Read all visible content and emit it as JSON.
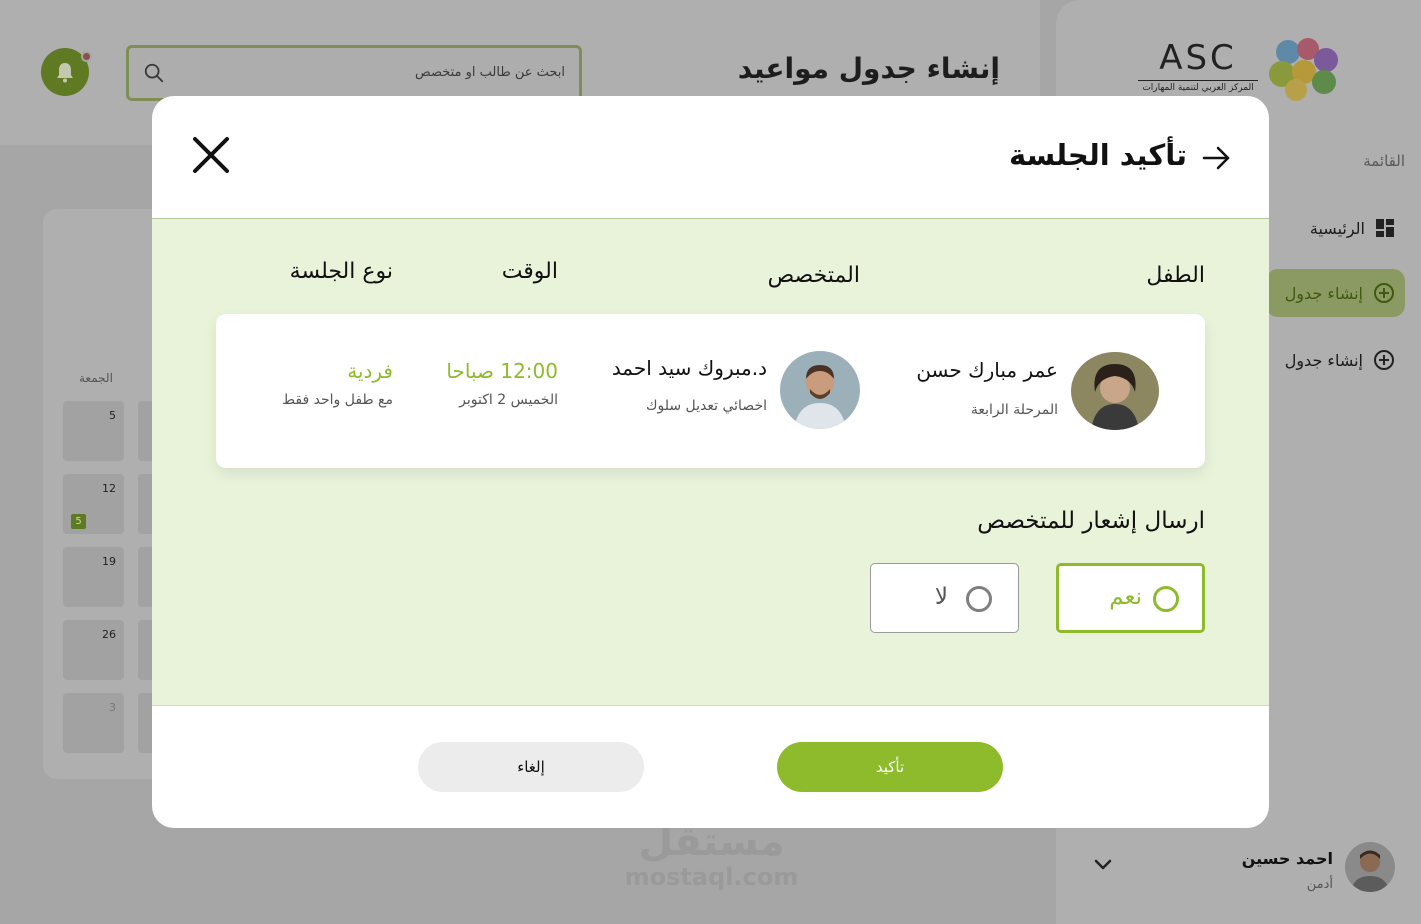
{
  "app": {
    "logo_text": "ASC",
    "logo_subtitle": "المركز العربي لتنمية المهارات",
    "page_title": "إنشاء جدول مواعيد",
    "search_placeholder": "ابحث عن طالب او متخصص"
  },
  "sidebar": {
    "caption": "القائمة",
    "items": [
      {
        "label": "الرئيسية",
        "icon": "dashboard-icon"
      },
      {
        "label": "إنشاء جدول",
        "icon": "plus-circle-icon"
      },
      {
        "label": "إنشاء جدول",
        "icon": "plus-circle-icon"
      }
    ],
    "profile": {
      "name": "احمد حسين",
      "role": "أدمن"
    }
  },
  "calendar": {
    "day_name": "الجمعة",
    "days": [
      "5",
      "12",
      "19",
      "26",
      "3"
    ],
    "badge": "5"
  },
  "modal": {
    "title": "تأكيد الجلسة",
    "columns": {
      "child": "الطفل",
      "specialist": "المتخصص",
      "time": "الوقت",
      "session_type": "نوع الجلسة"
    },
    "child": {
      "name": "عمر مبارك حسن",
      "level": "المرحلة الرابعة"
    },
    "specialist": {
      "name": "د.مبروك سيد احمد",
      "title": "اخصائي تعديل سلوك"
    },
    "time": {
      "time": "12:00 صباحا",
      "date": "الخميس 2 اكتوبر"
    },
    "session_type": {
      "type": "فردية",
      "note": "مع طفل واحد فقط"
    },
    "notify_label": "ارسال إشعار للمتخصص",
    "options": {
      "yes": "نعم",
      "no": "لا",
      "selected": "yes"
    },
    "confirm_label": "تأكيد",
    "cancel_label": "إلغاء"
  },
  "watermark": {
    "ar": "مستقل",
    "en": "mostaql.com"
  },
  "colors": {
    "accent": "#8dbb2c",
    "body_bg": "#e8f3da",
    "overlay": "#a6a6a6"
  }
}
